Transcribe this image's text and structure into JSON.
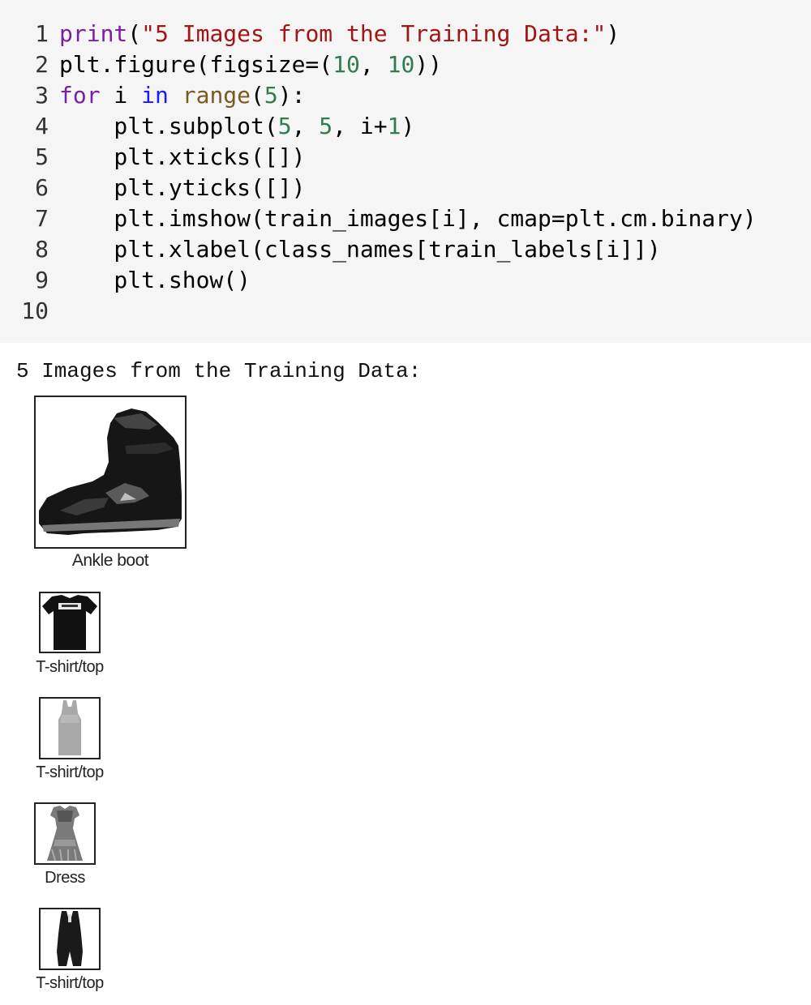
{
  "code": {
    "lines": [
      {
        "n": "1",
        "tokens": [
          [
            "print",
            "kw-b"
          ],
          [
            "(",
            ""
          ],
          [
            "\"5 Images from the Training Data:\"",
            "str"
          ],
          [
            ")",
            ""
          ]
        ]
      },
      {
        "n": "2",
        "tokens": [
          [
            "plt.figure(figsize=(",
            ""
          ],
          [
            "10",
            "num"
          ],
          [
            ", ",
            ""
          ],
          [
            "10",
            "num"
          ],
          [
            "))",
            ""
          ]
        ]
      },
      {
        "n": "3",
        "tokens": [
          [
            "for",
            "kw-b"
          ],
          [
            " i ",
            ""
          ],
          [
            "in",
            "kw-bl"
          ],
          [
            " ",
            ""
          ],
          [
            "range",
            "fn"
          ],
          [
            "(",
            ""
          ],
          [
            "5",
            "num"
          ],
          [
            "):",
            ""
          ]
        ]
      },
      {
        "n": "4",
        "tokens": [
          [
            "    plt.subplot(",
            ""
          ],
          [
            "5",
            "num"
          ],
          [
            ", ",
            ""
          ],
          [
            "5",
            "num"
          ],
          [
            ", i+",
            ""
          ],
          [
            "1",
            "num"
          ],
          [
            ")",
            ""
          ]
        ]
      },
      {
        "n": "5",
        "tokens": [
          [
            "    plt.xticks([])",
            ""
          ]
        ]
      },
      {
        "n": "6",
        "tokens": [
          [
            "    plt.yticks([])",
            ""
          ]
        ]
      },
      {
        "n": "7",
        "tokens": [
          [
            "    plt.imshow(train_images[i], cmap=plt.cm.binary)",
            ""
          ]
        ]
      },
      {
        "n": "8",
        "tokens": [
          [
            "    plt.xlabel(class_names[train_labels[i]])",
            ""
          ]
        ]
      },
      {
        "n": "9",
        "tokens": [
          [
            "    plt.show()",
            ""
          ]
        ]
      },
      {
        "n": "10",
        "tokens": []
      }
    ]
  },
  "output": {
    "printed_text": "5 Images from the Training Data:",
    "subplots": [
      {
        "label": "Ankle boot",
        "icon": "ankle-boot-image"
      },
      {
        "label": "T-shirt/top",
        "icon": "tshirt-image"
      },
      {
        "label": "T-shirt/top",
        "icon": "tank-top-image"
      },
      {
        "label": "Dress",
        "icon": "dress-image"
      },
      {
        "label": "T-shirt/top",
        "icon": "romper-image"
      }
    ]
  }
}
